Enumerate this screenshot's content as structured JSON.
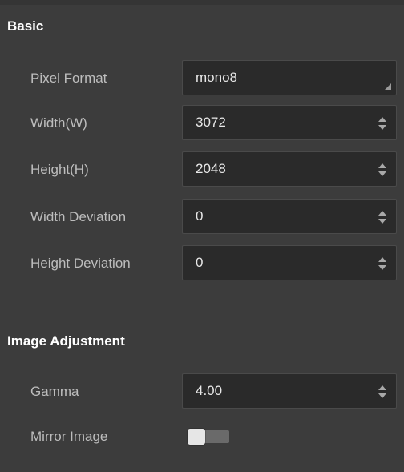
{
  "basic": {
    "header": "Basic",
    "pixel_format": {
      "label": "Pixel Format",
      "value": "mono8"
    },
    "width": {
      "label": "Width(W)",
      "value": "3072"
    },
    "height": {
      "label": "Height(H)",
      "value": "2048"
    },
    "width_deviation": {
      "label": "Width Deviation",
      "value": "0"
    },
    "height_deviation": {
      "label": "Height Deviation",
      "value": "0"
    }
  },
  "image_adjustment": {
    "header": "Image Adjustment",
    "gamma": {
      "label": "Gamma",
      "value": "4.00"
    },
    "mirror_image": {
      "label": "Mirror Image",
      "enabled": false
    }
  },
  "colors": {
    "panel_background": "#3c3c3c",
    "field_background": "#2a2a2a",
    "header_text": "#ffffff",
    "label_text": "#bdbdbd"
  },
  "icons": {
    "dropdown": "dropdown-corner-icon",
    "spinner": "spinner-arrows-icon"
  }
}
